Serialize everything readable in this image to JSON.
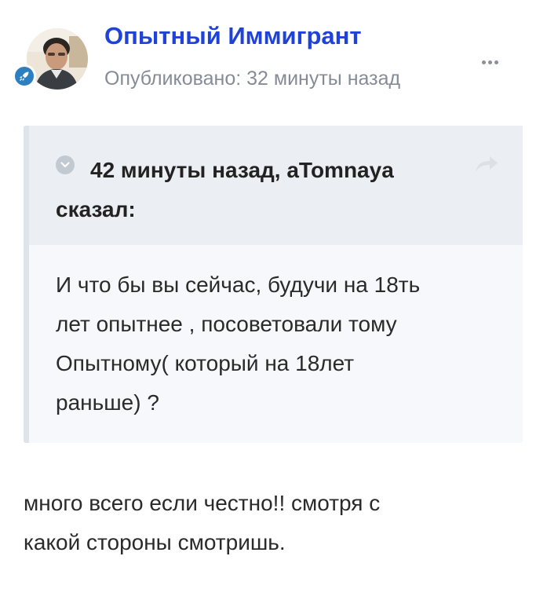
{
  "author": {
    "name": "Опытный Иммигрант",
    "published": "Опубликовано: 32 минуты назад",
    "avatar_icon": "user-avatar-photo",
    "rank_icon": "rocket-icon",
    "rank_color": "#2c7fc0",
    "name_color": "#1f42d8"
  },
  "menu": {
    "icon": "more-options-icon"
  },
  "quote": {
    "citation": "42 минуты назад, аTomnaya сказал:",
    "collapse_icon": "chevron-down-icon",
    "share_icon": "share-arrow-icon",
    "lines": [
      "И что бы вы сейчас, будучи на 18ть",
      "лет опытнее , посоветовали тому",
      "Опытному( который на 18лет",
      "раньше) ?"
    ]
  },
  "reply": {
    "lines": [
      "много всего если честно!! смотря с",
      "какой стороны смотришь."
    ]
  }
}
